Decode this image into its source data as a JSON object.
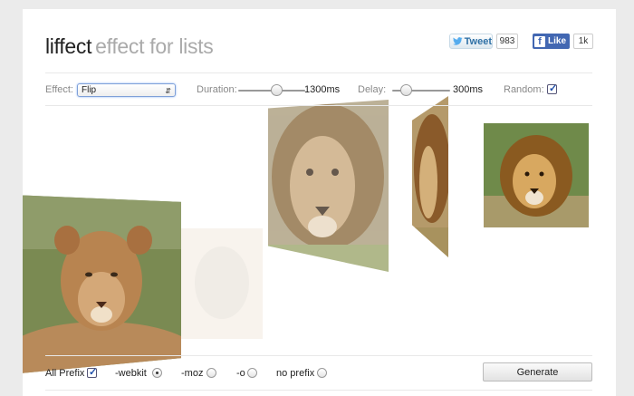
{
  "header": {
    "title_main": "liffect",
    "title_sub": "effect for lists",
    "tweet_label": "Tweet",
    "tweet_count": "983",
    "like_label": "Like",
    "like_count": "1k"
  },
  "controls": {
    "effect_label": "Effect:",
    "effect_value": "Flip",
    "duration_label": "Duration:",
    "duration_value": "1300ms",
    "delay_label": "Delay:",
    "delay_value": "300ms",
    "random_label": "Random:",
    "random_checked": true
  },
  "prefix": {
    "all_prefix_label": "All Prefix",
    "webkit_label": "-webkit",
    "moz_label": "-moz",
    "o_label": "-o",
    "no_prefix_label": "no prefix",
    "selected": "-webkit",
    "generate_label": "Generate"
  },
  "gallery": {
    "images": [
      "lioness-icon",
      "lion-icon",
      "lion-icon",
      "lion-icon",
      "lion-icon"
    ]
  }
}
